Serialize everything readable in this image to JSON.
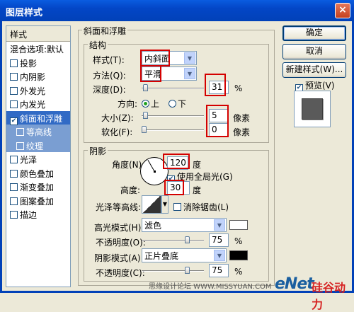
{
  "window": {
    "title": "图层样式",
    "close_glyph": "×"
  },
  "styles_panel": {
    "header": "样式",
    "items": [
      {
        "label": "混合选项:默认",
        "checkbox": false,
        "checked": false,
        "state": "normal"
      },
      {
        "label": "投影",
        "checkbox": true,
        "checked": false,
        "state": "normal"
      },
      {
        "label": "内阴影",
        "checkbox": true,
        "checked": false,
        "state": "normal"
      },
      {
        "label": "外发光",
        "checkbox": true,
        "checked": false,
        "state": "normal"
      },
      {
        "label": "内发光",
        "checkbox": true,
        "checked": false,
        "state": "normal"
      },
      {
        "label": "斜面和浮雕",
        "checkbox": true,
        "checked": true,
        "state": "selected"
      },
      {
        "label": "等高线",
        "checkbox": true,
        "checked": false,
        "state": "sub"
      },
      {
        "label": "纹理",
        "checkbox": true,
        "checked": false,
        "state": "sub"
      },
      {
        "label": "光泽",
        "checkbox": true,
        "checked": false,
        "state": "normal"
      },
      {
        "label": "颜色叠加",
        "checkbox": true,
        "checked": false,
        "state": "normal"
      },
      {
        "label": "渐变叠加",
        "checkbox": true,
        "checked": false,
        "state": "normal"
      },
      {
        "label": "图案叠加",
        "checkbox": true,
        "checked": false,
        "state": "normal"
      },
      {
        "label": "描边",
        "checkbox": true,
        "checked": false,
        "state": "normal"
      }
    ]
  },
  "bevel": {
    "group_title": "斜面和浮雕",
    "structure": {
      "title": "结构",
      "style_label": "样式(T):",
      "style_value": "内斜面",
      "technique_label": "方法(Q):",
      "technique_value": "平滑",
      "depth_label": "深度(D):",
      "depth_value": "31",
      "depth_unit": "%",
      "depth_level": 0.03,
      "direction_label": "方向:",
      "dir_up": "上",
      "dir_down": "下",
      "size_label": "大小(Z):",
      "size_value": "5",
      "size_unit": "像素",
      "size_level": 0.02,
      "soften_label": "软化(F):",
      "soften_value": "0",
      "soften_unit": "像素",
      "soften_level": 0.0
    },
    "shading": {
      "title": "阴影",
      "angle_label": "角度(N):",
      "angle_value": "120",
      "angle_unit": "度",
      "global_light_label": "使用全局光(G)",
      "altitude_label": "高度:",
      "altitude_value": "30",
      "altitude_unit": "度",
      "gloss_label": "光泽等高线:",
      "antialias_label": "消除锯齿(L)",
      "highlight_mode_label": "高光模式(H):",
      "highlight_mode_value": "滤色",
      "highlight_color": "#ffffff",
      "highlight_opacity_label": "不透明度(O):",
      "highlight_opacity_value": "75",
      "highlight_opacity_unit": "%",
      "highlight_opacity_level": 0.75,
      "shadow_mode_label": "阴影模式(A):",
      "shadow_mode_value": "正片叠底",
      "shadow_color": "#000000",
      "shadow_opacity_label": "不透明度(C):",
      "shadow_opacity_value": "75",
      "shadow_opacity_unit": "%",
      "shadow_opacity_level": 0.75
    }
  },
  "buttons": {
    "ok": "确定",
    "cancel": "取消",
    "new_style": "新建样式(W)...",
    "preview": "预览(V)"
  },
  "watermark": {
    "site": "思缘设计论坛 WWW.MISSYUAN.COM",
    "brand": "eNet",
    "brand_cn": "硅谷动力"
  },
  "colors": {
    "title_bar": "#0346c6",
    "selection": "#316ac5",
    "sub_selection": "#7a9ed2",
    "highlight_box": "#d40000"
  }
}
